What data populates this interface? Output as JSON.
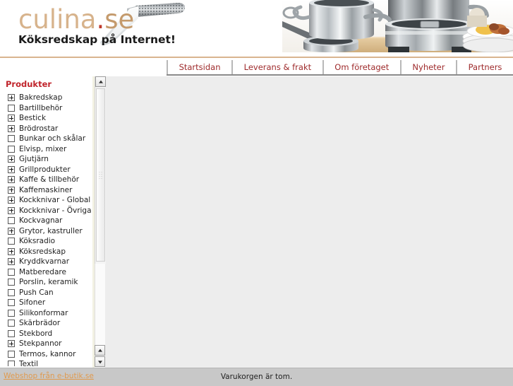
{
  "site": {
    "logo_part_a": "culina",
    "logo_dot": ".",
    "logo_part_b": "se",
    "tagline": "Köksredskap på Internet!"
  },
  "nav": {
    "items": [
      {
        "label": "Startsidan"
      },
      {
        "label": "Leverans & frakt"
      },
      {
        "label": "Om företaget"
      },
      {
        "label": "Nyheter"
      },
      {
        "label": "Partners"
      }
    ]
  },
  "sidebar": {
    "title": "Produkter",
    "items": [
      {
        "label": "Bakredskap",
        "expandable": true
      },
      {
        "label": "Bartillbehör",
        "expandable": false
      },
      {
        "label": "Bestick",
        "expandable": true
      },
      {
        "label": "Brödrostar",
        "expandable": true
      },
      {
        "label": "Bunkar och skålar",
        "expandable": false
      },
      {
        "label": "Elvisp, mixer",
        "expandable": false
      },
      {
        "label": "Gjutjärn",
        "expandable": true
      },
      {
        "label": "Grillprodukter",
        "expandable": true
      },
      {
        "label": "Kaffe & tillbehör",
        "expandable": true
      },
      {
        "label": "Kaffemaskiner",
        "expandable": true
      },
      {
        "label": "Kockknivar - Global",
        "expandable": true
      },
      {
        "label": "Kockknivar - Övriga",
        "expandable": true
      },
      {
        "label": "Kockvagnar",
        "expandable": false
      },
      {
        "label": "Grytor, kastruller",
        "expandable": true
      },
      {
        "label": "Köksradio",
        "expandable": false
      },
      {
        "label": "Köksredskap",
        "expandable": true
      },
      {
        "label": "Kryddkvarnar",
        "expandable": true
      },
      {
        "label": "Matberedare",
        "expandable": false
      },
      {
        "label": "Porslin, keramik",
        "expandable": false
      },
      {
        "label": "Push Can",
        "expandable": false
      },
      {
        "label": "Sifoner",
        "expandable": false
      },
      {
        "label": "Silikonformar",
        "expandable": false
      },
      {
        "label": "Skärbrädor",
        "expandable": false
      },
      {
        "label": "Stekbord",
        "expandable": false
      },
      {
        "label": "Stekpannor",
        "expandable": true
      },
      {
        "label": "Termos, kannor",
        "expandable": false
      },
      {
        "label": "Textil",
        "expandable": false
      }
    ]
  },
  "footer": {
    "link": "Webshop från e-butik.se",
    "cart_status": "Varukorgen är tom."
  },
  "icons": {
    "scroll_up": "scroll-up-arrow-icon",
    "scroll_down": "scroll-down-arrow-icon",
    "expand": "expand-plus-icon"
  },
  "colors": {
    "brand_red": "#c0242b",
    "nav_red": "#9e2a2b",
    "logo_tan": "#d7b38c",
    "logo_tan_dark": "#c49a6c",
    "link_orange": "#e09a4e",
    "rule_tan": "#d9b48f",
    "content_gray": "#ededed",
    "footer_gray": "#c8c8c8"
  }
}
